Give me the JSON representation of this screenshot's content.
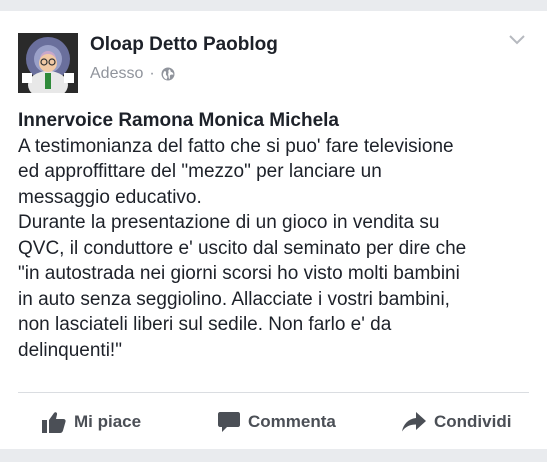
{
  "post": {
    "author": "Oloap Detto Paoblog",
    "time": "Adesso",
    "separator": "·",
    "title": "Innervoice Ramona Monica Michela",
    "lines": [
      "A testimonianza del fatto che si puo' fare televisione",
      "ed approffittare del \"mezzo\" per lanciare un",
      "messaggio educativo.",
      "Durante la presentazione di un gioco in vendita su",
      "QVC,  il conduttore e' uscito dal seminato per dire che",
      "\"in autostrada nei giorni scorsi ho visto molti bambini",
      "in auto senza seggiolino. Allacciate i vostri bambini,",
      "non lasciateli liberi sul sedile. Non farlo e' da",
      "delinquenti!\""
    ]
  },
  "actions": {
    "like": "Mi piace",
    "comment": "Commenta",
    "share": "Condividi"
  },
  "icons": {
    "privacy": "globe-icon",
    "options": "chevron-down-icon",
    "like": "thumbs-up-icon",
    "comment": "speech-bubble-icon",
    "share": "share-arrow-icon"
  },
  "colors": {
    "background": "#e9ebee",
    "card": "#ffffff",
    "text": "#1d2129",
    "meta": "#90949c",
    "action": "#4b4f56"
  }
}
